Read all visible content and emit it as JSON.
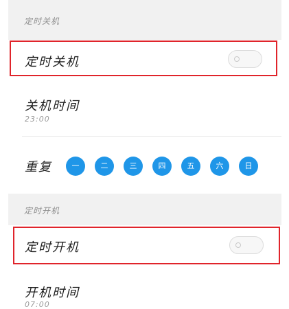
{
  "shutdown_section": {
    "header": "定时关机",
    "toggle_row": {
      "label": "定时关机",
      "enabled": false
    },
    "time_row": {
      "label": "关机时间",
      "value": "23:00"
    }
  },
  "repeat_row": {
    "label": "重复",
    "days": [
      "一",
      "二",
      "三",
      "四",
      "五",
      "六",
      "日"
    ],
    "day_color": "#1f96e8"
  },
  "startup_section": {
    "header": "定时开机",
    "toggle_row": {
      "label": "定时开机",
      "enabled": false
    },
    "time_row": {
      "label": "开机时间",
      "value": "07:00"
    }
  },
  "highlight_color": "#e0242b"
}
